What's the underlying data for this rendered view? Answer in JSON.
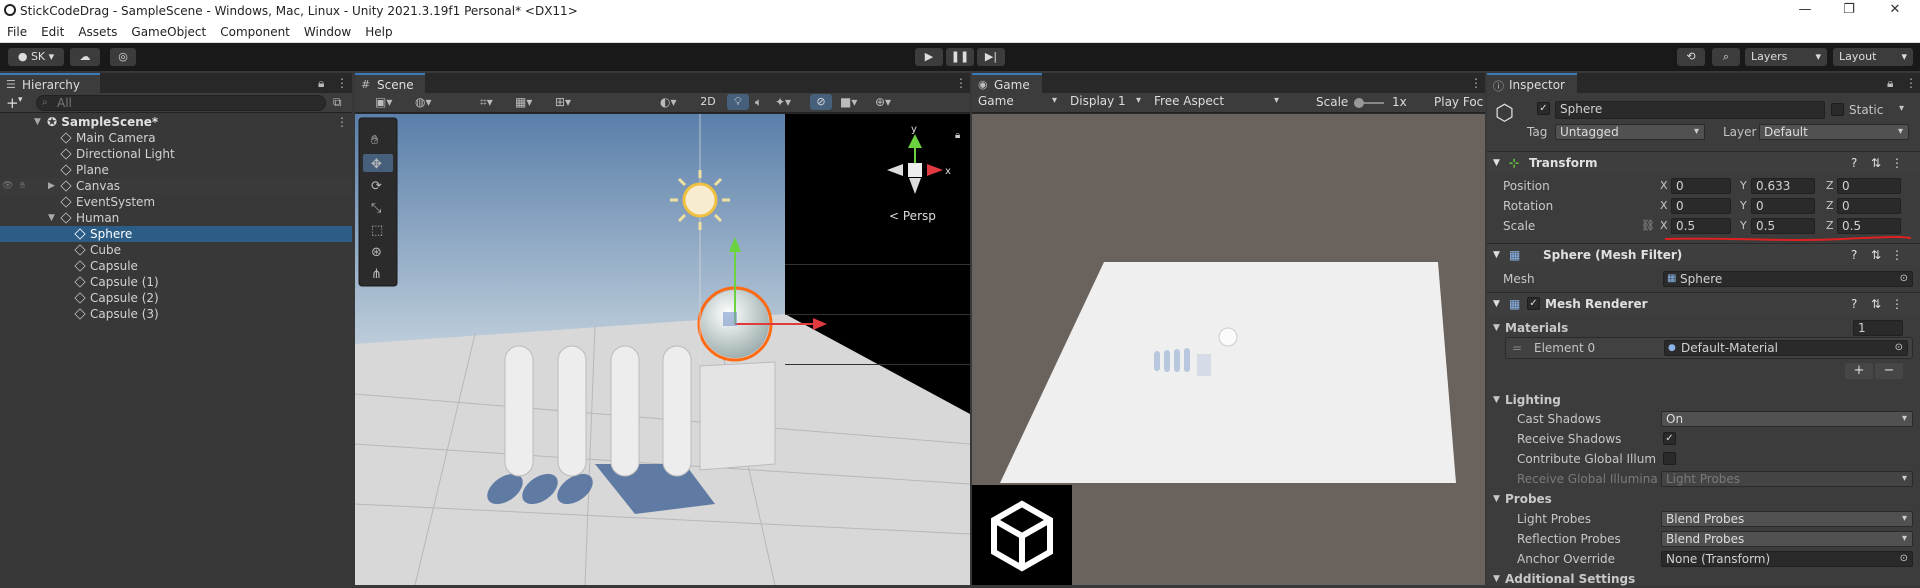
{
  "title_bar": {
    "title": "StickCodeDrag - SampleScene - Windows, Mac, Linux - Unity 2021.3.19f1 Personal* <DX11>",
    "minimize": "—",
    "maximize": "❐",
    "close": "✕"
  },
  "menu": [
    "File",
    "Edit",
    "Assets",
    "GameObject",
    "Component",
    "Window",
    "Help"
  ],
  "toolbar": {
    "account": "SK",
    "layers": "Layers",
    "layout": "Layout"
  },
  "hierarchy": {
    "tab": "Hierarchy",
    "add": "+",
    "search_placeholder": "All",
    "scene": "SampleScene*",
    "items": [
      "Main Camera",
      "Directional Light",
      "Plane",
      "Canvas",
      "EventSystem",
      "Human",
      "Sphere",
      "Cube",
      "Capsule",
      "Capsule (1)",
      "Capsule (2)",
      "Capsule (3)"
    ]
  },
  "scene": {
    "tab": "Scene",
    "mode_2d": "2D",
    "persp": "Persp",
    "gizmo_x": "x",
    "gizmo_y": "y"
  },
  "game": {
    "tab": "Game",
    "view": "Game",
    "display": "Display 1",
    "aspect": "Free Aspect",
    "scale": "Scale",
    "scale_value": "1x",
    "play_focused": "Play Foc"
  },
  "inspector": {
    "tab": "Inspector",
    "object_name": "Sphere",
    "static": "Static",
    "tag_label": "Tag",
    "tag": "Untagged",
    "layer_label": "Layer",
    "layer": "Default",
    "transform": {
      "title": "Transform",
      "position_label": "Position",
      "position": {
        "x": "0",
        "y": "0.633",
        "z": "0"
      },
      "rotation_label": "Rotation",
      "rotation": {
        "x": "0",
        "y": "0",
        "z": "0"
      },
      "scale_label": "Scale",
      "scale": {
        "x": "0.5",
        "y": "0.5",
        "z": "0.5"
      },
      "axis_x": "X",
      "axis_y": "Y",
      "axis_z": "Z"
    },
    "mesh_filter": {
      "title": "Sphere (Mesh Filter)",
      "mesh_label": "Mesh",
      "mesh": "Sphere"
    },
    "mesh_renderer": {
      "title": "Mesh Renderer",
      "materials_label": "Materials",
      "materials_count": "1",
      "element0_label": "Element 0",
      "element0": "Default-Material",
      "lighting_label": "Lighting",
      "cast_shadows_label": "Cast Shadows",
      "cast_shadows": "On",
      "receive_shadows_label": "Receive Shadows",
      "contribute_gi_label": "Contribute Global Illumina",
      "receive_gi_label": "Receive Global Illuminatio",
      "receive_gi": "Light Probes",
      "probes_label": "Probes",
      "light_probes_label": "Light Probes",
      "light_probes": "Blend Probes",
      "reflection_probes_label": "Reflection Probes",
      "reflection_probes": "Blend Probes",
      "anchor_override_label": "Anchor Override",
      "anchor_override": "None (Transform)"
    },
    "additional_settings": "Additional Settings"
  },
  "colors": {
    "selection": "#2c5d87",
    "annotation_line": "#e02020",
    "selection_outline": "#ff6a13"
  }
}
